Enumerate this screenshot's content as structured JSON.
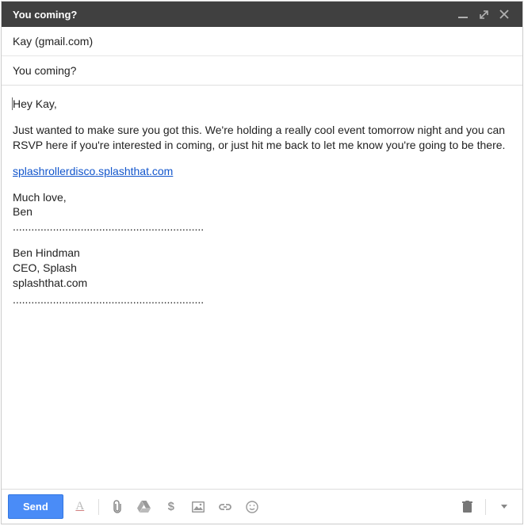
{
  "titlebar": {
    "title": "You coming?"
  },
  "fields": {
    "to": "Kay (gmail.com)",
    "subject": "You coming?"
  },
  "body": {
    "greeting": "Hey Kay,",
    "paragraph": "Just wanted to make sure you got this. We're holding a really cool event tomorrow night and you can RSVP here if you're interested in coming, or just hit me back to let me know you're going to be there.",
    "link_text": "splashrollerdisco.splashthat.com",
    "closing1": "Much love,",
    "closing2": "Ben",
    "sig_sep": "..............................................................",
    "sig_name": "Ben Hindman",
    "sig_title": "CEO, Splash",
    "sig_site": "splashthat.com",
    "sig_sep2": ".............................................................."
  },
  "toolbar": {
    "send_label": "Send"
  }
}
